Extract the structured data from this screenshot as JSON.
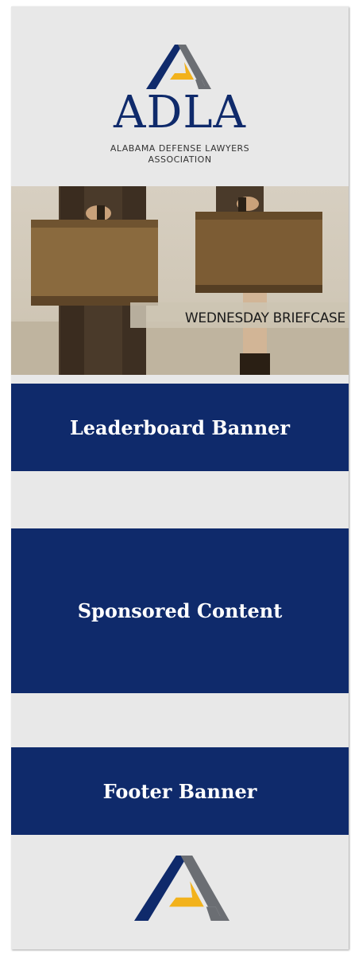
{
  "header": {
    "logo_text": "ADLA",
    "logo_subtitle_line1": "ALABAMA DEFENSE LAWYERS",
    "logo_subtitle_line2": "ASSOCIATION"
  },
  "hero": {
    "caption": "WEDNESDAY BRIEFCASE"
  },
  "blocks": {
    "leaderboard": "Leaderboard Banner",
    "sponsored": "Sponsored Content",
    "footer": "Footer Banner"
  },
  "colors": {
    "navy": "#0f2a6b",
    "gray": "#6b6e73",
    "gold": "#f2b21c",
    "panel_bg": "#e8e8e8"
  },
  "icons": {
    "logo_mark": "adla-triangle-icon"
  }
}
